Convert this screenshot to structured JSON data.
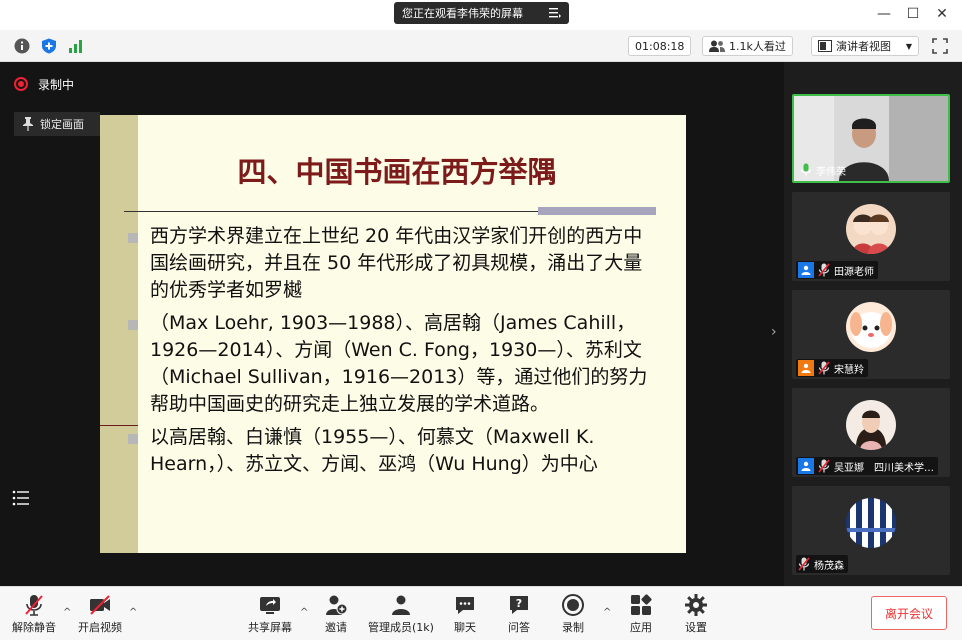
{
  "share_banner": {
    "text": "您正在观看李伟荣的屏幕"
  },
  "window_controls": [
    "minimize-button",
    "maximize-button",
    "close-button"
  ],
  "info_bar": {
    "timer": "01:08:18",
    "viewers": "1.1k人看过",
    "view_mode": "演讲者视图"
  },
  "main": {
    "recording_label": "录制中",
    "lock_label": "锁定画面"
  },
  "slide": {
    "title": "四、中国书画在西方举隅",
    "bullets": [
      "西方学术界建立在上世纪 20 年代由汉学家们开创的西方中国绘画研究，并且在 50 年代形成了初具规模，涌出了大量的优秀学者如罗樾",
      "（Max Loehr, 1903—1988）、高居翰（James Cahill，1926—2014）、方闻（Wen C. Fong，1930—）、苏利文（Michael Sullivan，1916—2013）等，通过他们的努力帮助中国画史的研究走上独立发展的学术道路。",
      "以高居翰、白谦慎（1955—）、何慕文（Maxwell K. Hearn，）、苏立文、方闻、巫鸿（Wu Hung）为中心"
    ],
    "colors": {
      "title": "#7d1a1a",
      "background": "#fdfde7",
      "sidebar": "#d1cc99"
    }
  },
  "participants": [
    {
      "name": "李伟荣",
      "active": true
    },
    {
      "name": "田源老师"
    },
    {
      "name": "宋慧羚"
    },
    {
      "name": "吴亚娜　四川美术学…"
    },
    {
      "name": "杨茂森"
    }
  ],
  "toolbar": {
    "unmute": "解除静音",
    "start_video": "开启视频",
    "share_screen": "共享屏幕",
    "invite": "邀请",
    "manage_members": "管理成员(1k)",
    "chat": "聊天",
    "qa": "问答",
    "record": "录制",
    "apps": "应用",
    "settings": "设置",
    "leave": "离开会议"
  }
}
